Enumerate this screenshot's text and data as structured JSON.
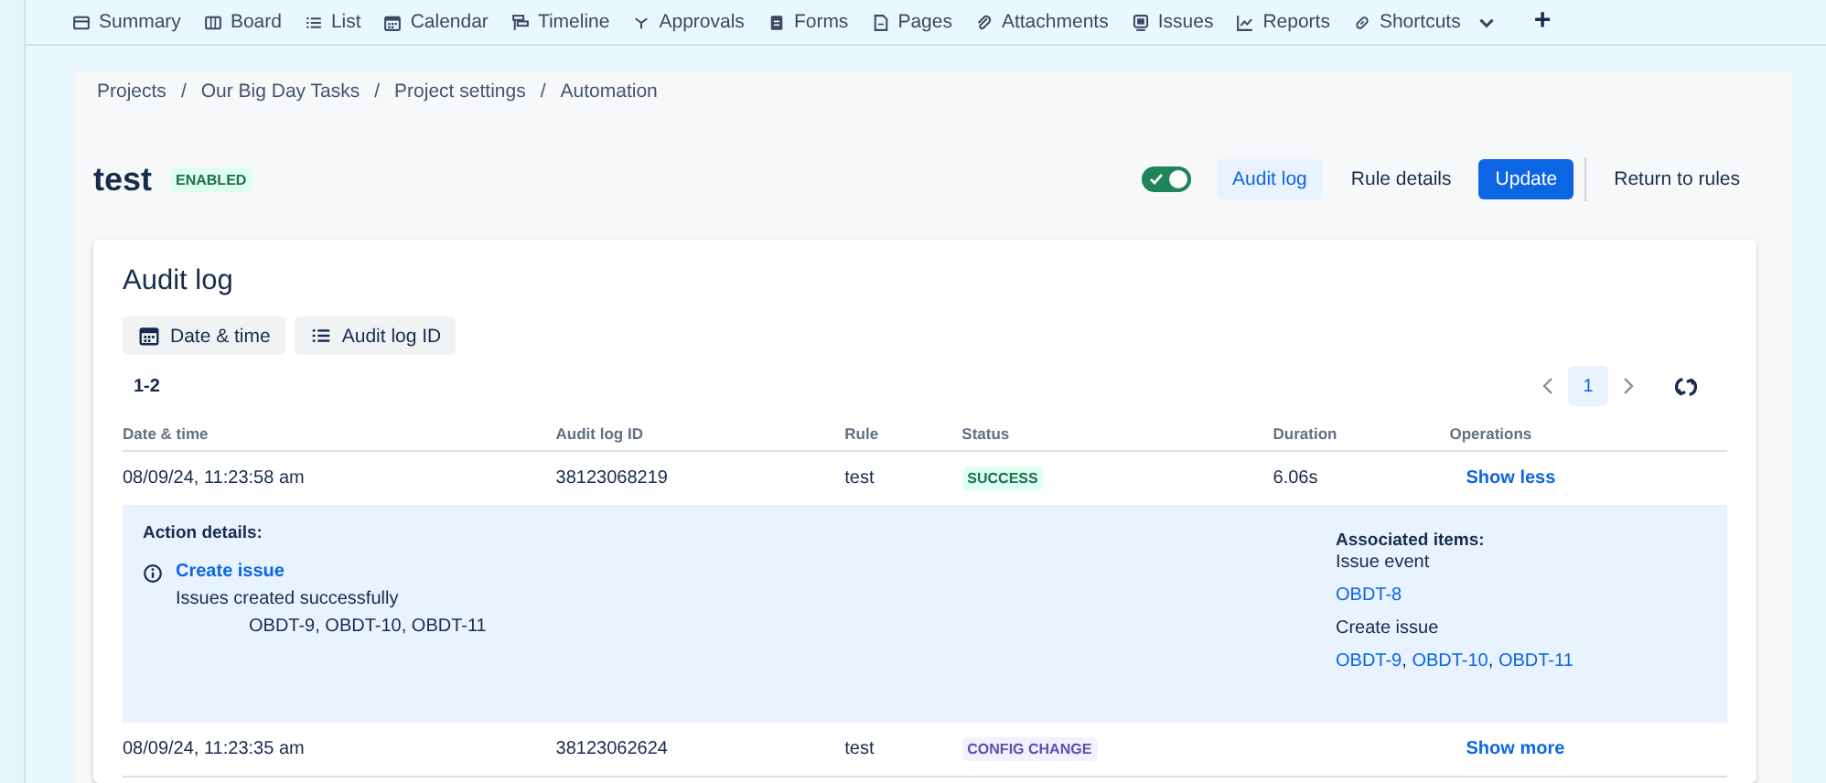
{
  "nav": {
    "tabs": [
      {
        "label": "Summary",
        "dropdown": false
      },
      {
        "label": "Board",
        "dropdown": false
      },
      {
        "label": "List",
        "dropdown": false
      },
      {
        "label": "Calendar",
        "dropdown": false
      },
      {
        "label": "Timeline",
        "dropdown": false
      },
      {
        "label": "Approvals",
        "dropdown": false
      },
      {
        "label": "Forms",
        "dropdown": false
      },
      {
        "label": "Pages",
        "dropdown": false
      },
      {
        "label": "Attachments",
        "dropdown": false
      },
      {
        "label": "Issues",
        "dropdown": false
      },
      {
        "label": "Reports",
        "dropdown": false
      },
      {
        "label": "Shortcuts",
        "dropdown": true
      }
    ],
    "add_button": "+"
  },
  "breadcrumbs": [
    "Projects",
    "Our Big Day Tasks",
    "Project settings",
    "Automation"
  ],
  "breadcrumb_separator": "/",
  "rule": {
    "title": "test",
    "status": "ENABLED",
    "toggle_on": true
  },
  "header_buttons": [
    {
      "label": "Audit log",
      "kind": "subtle",
      "selected": true
    },
    {
      "label": "Rule details",
      "kind": "subtle",
      "selected": false
    },
    {
      "label": "Update",
      "kind": "primary",
      "selected": false
    },
    {
      "label": "Return to rules",
      "kind": "divided",
      "selected": false
    }
  ],
  "audit_log": {
    "title": "Audit log",
    "filters": [
      {
        "label": "Date & time"
      },
      {
        "label": "Audit log ID"
      }
    ],
    "range": "1-2",
    "pages": [
      {
        "label": "1",
        "selected": true
      }
    ],
    "table": {
      "columns": [
        "Date & time",
        "Audit log ID",
        "Rule",
        "Status",
        "Duration",
        "Operations"
      ],
      "rows": [
        {
          "date": "08/09/24, 11:23:58 am",
          "id": "38123068219",
          "rule": "test",
          "status": "SUCCESS",
          "duration": "6.06s",
          "operation": "Show less",
          "expanded": true,
          "details": {
            "title": "Action details:",
            "action": "Create issue",
            "message": "Issues created successfully",
            "issues": "OBDT-9, OBDT-10, OBDT-11",
            "associated_title": "Associated items:",
            "separator": ",",
            "groups": [
              {
                "label": "Issue event",
                "links": [
                  "OBDT-8"
                ]
              },
              {
                "label": "Create issue",
                "links": [
                  "OBDT-9",
                  "OBDT-10",
                  "OBDT-11"
                ]
              }
            ]
          }
        },
        {
          "date": "08/09/24, 11:23:35 am",
          "id": "38123062624",
          "rule": "test",
          "status": "CONFIG CHANGE",
          "duration": "",
          "operation": "Show more",
          "expanded": false
        }
      ]
    }
  }
}
